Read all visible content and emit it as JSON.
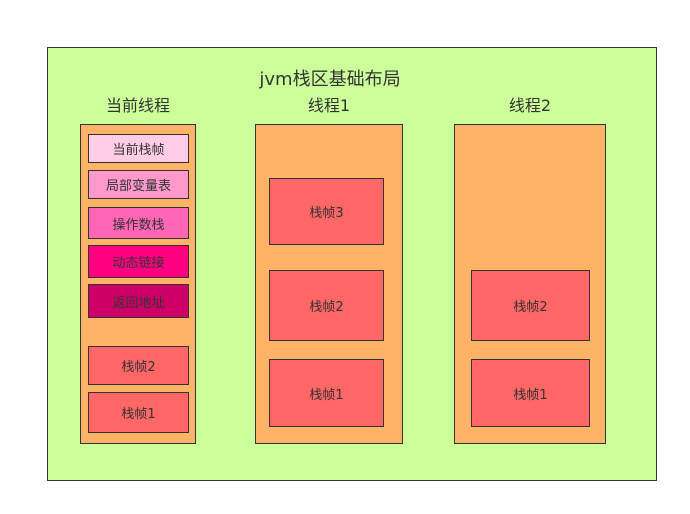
{
  "title": "jvm栈区基础布局",
  "current_thread": {
    "label": "当前线程",
    "current_frame_parts": [
      {
        "label": "当前栈帧",
        "color": "#ffcce6"
      },
      {
        "label": "局部变量表",
        "color": "#ff99cc"
      },
      {
        "label": "操作数栈",
        "color": "#ff66b3"
      },
      {
        "label": "动态链接",
        "color": "#ff0080"
      },
      {
        "label": "返回地址",
        "color": "#cc0066"
      }
    ],
    "frames": [
      "栈帧2",
      "栈帧1"
    ]
  },
  "thread1": {
    "label": "线程1",
    "frames": [
      "栈帧3",
      "栈帧2",
      "栈帧1"
    ]
  },
  "thread2": {
    "label": "线程2",
    "frames": [
      "栈帧2",
      "栈帧1"
    ]
  },
  "colors": {
    "background": "#ccff99",
    "thread_column": "#ffb366",
    "stack_frame": "#ff6666",
    "border": "#333333"
  }
}
